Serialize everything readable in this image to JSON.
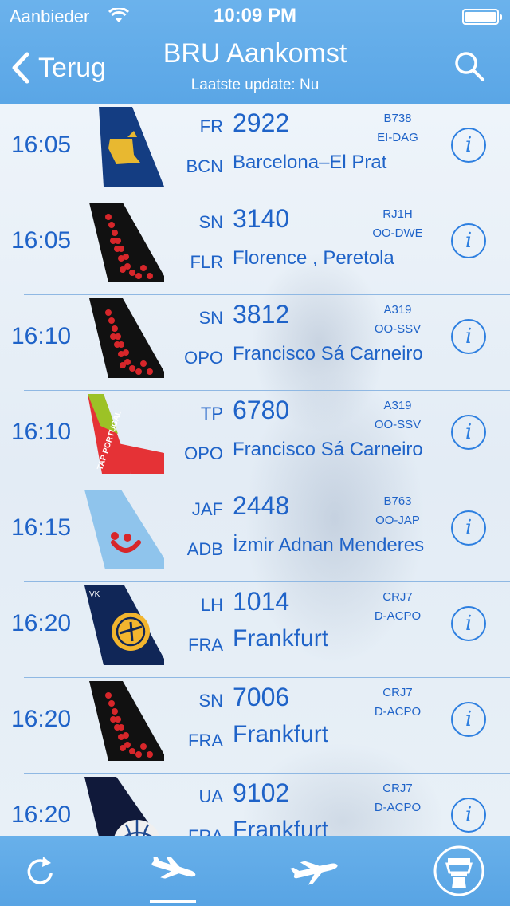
{
  "status_bar": {
    "carrier": "Aanbieder",
    "time": "10:09 PM"
  },
  "nav": {
    "back_label": "Terug",
    "title": "BRU Aankomst",
    "subtitle": "Laatste update: Nu"
  },
  "colors": {
    "header": "#5aa6e6",
    "text": "#1f63c8",
    "separator": "#8fb8e3"
  },
  "flights": [
    {
      "time": "16:05",
      "airline": "FR",
      "flight": "2922",
      "origin": "BCN",
      "city": "Barcelona–El Prat",
      "aircraft": "B738",
      "registration": "EI-DAG",
      "tail": "ryanair"
    },
    {
      "time": "16:05",
      "airline": "SN",
      "flight": "3140",
      "origin": "FLR",
      "city": "Florence , Peretola",
      "aircraft": "RJ1H",
      "registration": "OO-DWE",
      "tail": "brussels"
    },
    {
      "time": "16:10",
      "airline": "SN",
      "flight": "3812",
      "origin": "OPO",
      "city": "Francisco Sá Carneiro",
      "aircraft": "A319",
      "registration": "OO-SSV",
      "tail": "brussels"
    },
    {
      "time": "16:10",
      "airline": "TP",
      "flight": "6780",
      "origin": "OPO",
      "city": "Francisco Sá Carneiro",
      "aircraft": "A319",
      "registration": "OO-SSV",
      "tail": "tap",
      "tail_text": "TAP PORTUGAL"
    },
    {
      "time": "16:15",
      "airline": "JAF",
      "flight": "2448",
      "origin": "ADB",
      "city": "İzmir Adnan Menderes",
      "aircraft": "B763",
      "registration": "OO-JAP",
      "tail": "tui"
    },
    {
      "time": "16:20",
      "airline": "LH",
      "flight": "1014",
      "origin": "FRA",
      "city": "Frankfurt",
      "aircraft": "CRJ7",
      "registration": "D-ACPO",
      "tail": "lufthansa",
      "tail_text": "VK"
    },
    {
      "time": "16:20",
      "airline": "SN",
      "flight": "7006",
      "origin": "FRA",
      "city": "Frankfurt",
      "aircraft": "CRJ7",
      "registration": "D-ACPO",
      "tail": "brussels"
    },
    {
      "time": "16:20",
      "airline": "UA",
      "flight": "9102",
      "origin": "FRA",
      "city": "Frankfurt",
      "aircraft": "CRJ7",
      "registration": "D-ACPO",
      "tail": "united"
    }
  ],
  "tabs": [
    {
      "name": "refresh-icon"
    },
    {
      "name": "arrivals-icon",
      "selected": true
    },
    {
      "name": "departures-icon"
    },
    {
      "name": "control-tower-icon"
    }
  ]
}
